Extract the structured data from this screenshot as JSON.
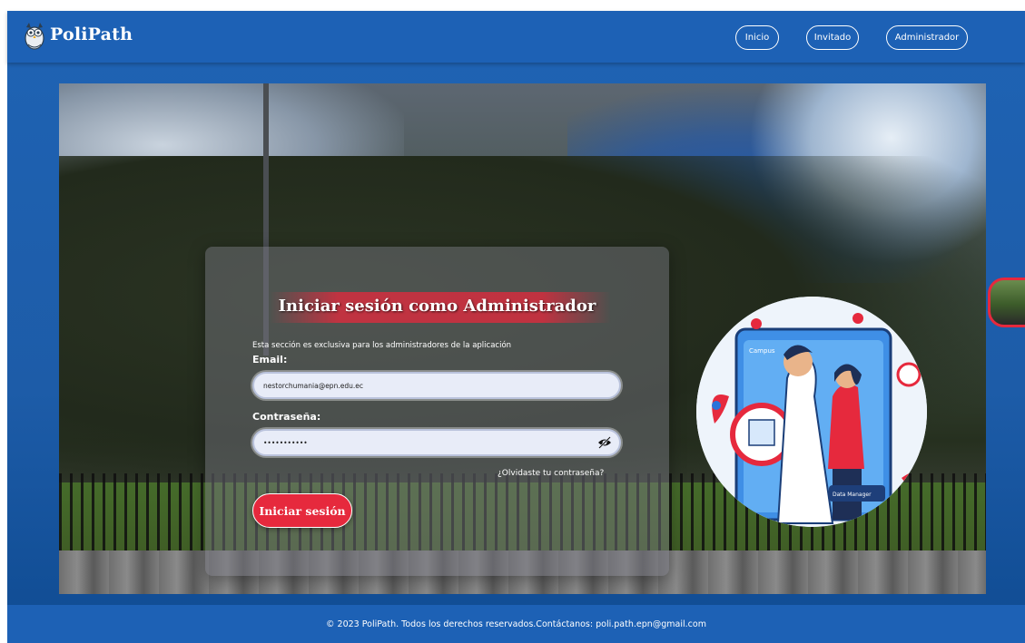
{
  "app": {
    "brand": "PoliPath"
  },
  "nav": {
    "items": [
      {
        "label": "Inicio"
      },
      {
        "label": "Invitado"
      },
      {
        "label": "Administrador"
      }
    ]
  },
  "login": {
    "title": "Iniciar sesión como Administrador",
    "subtitle": "Esta sección es exclusiva para los administradores de la aplicación",
    "email_label": "Email:",
    "email_value": "nestorchumania@epn.edu.ec",
    "password_label": "Contraseña:",
    "password_value": "•••••••••••",
    "forgot_link": "¿Olvidaste tu contraseña?",
    "submit_label": "Iniciar sesión"
  },
  "illustration": {
    "campus_label": "Campus",
    "card_label": "Data Manager"
  },
  "footer": {
    "text": "© 2023 PoliPath. Todos los derechos reservados.Contáctanos: poli.path.epn@gmail.com"
  },
  "colors": {
    "header_blue": "#1d61b5",
    "accent_red": "#e6293d",
    "input_bg": "#e8ecf8"
  },
  "icons": {
    "logo": "owl-logo-icon",
    "password_toggle": "eye-slash-icon"
  }
}
